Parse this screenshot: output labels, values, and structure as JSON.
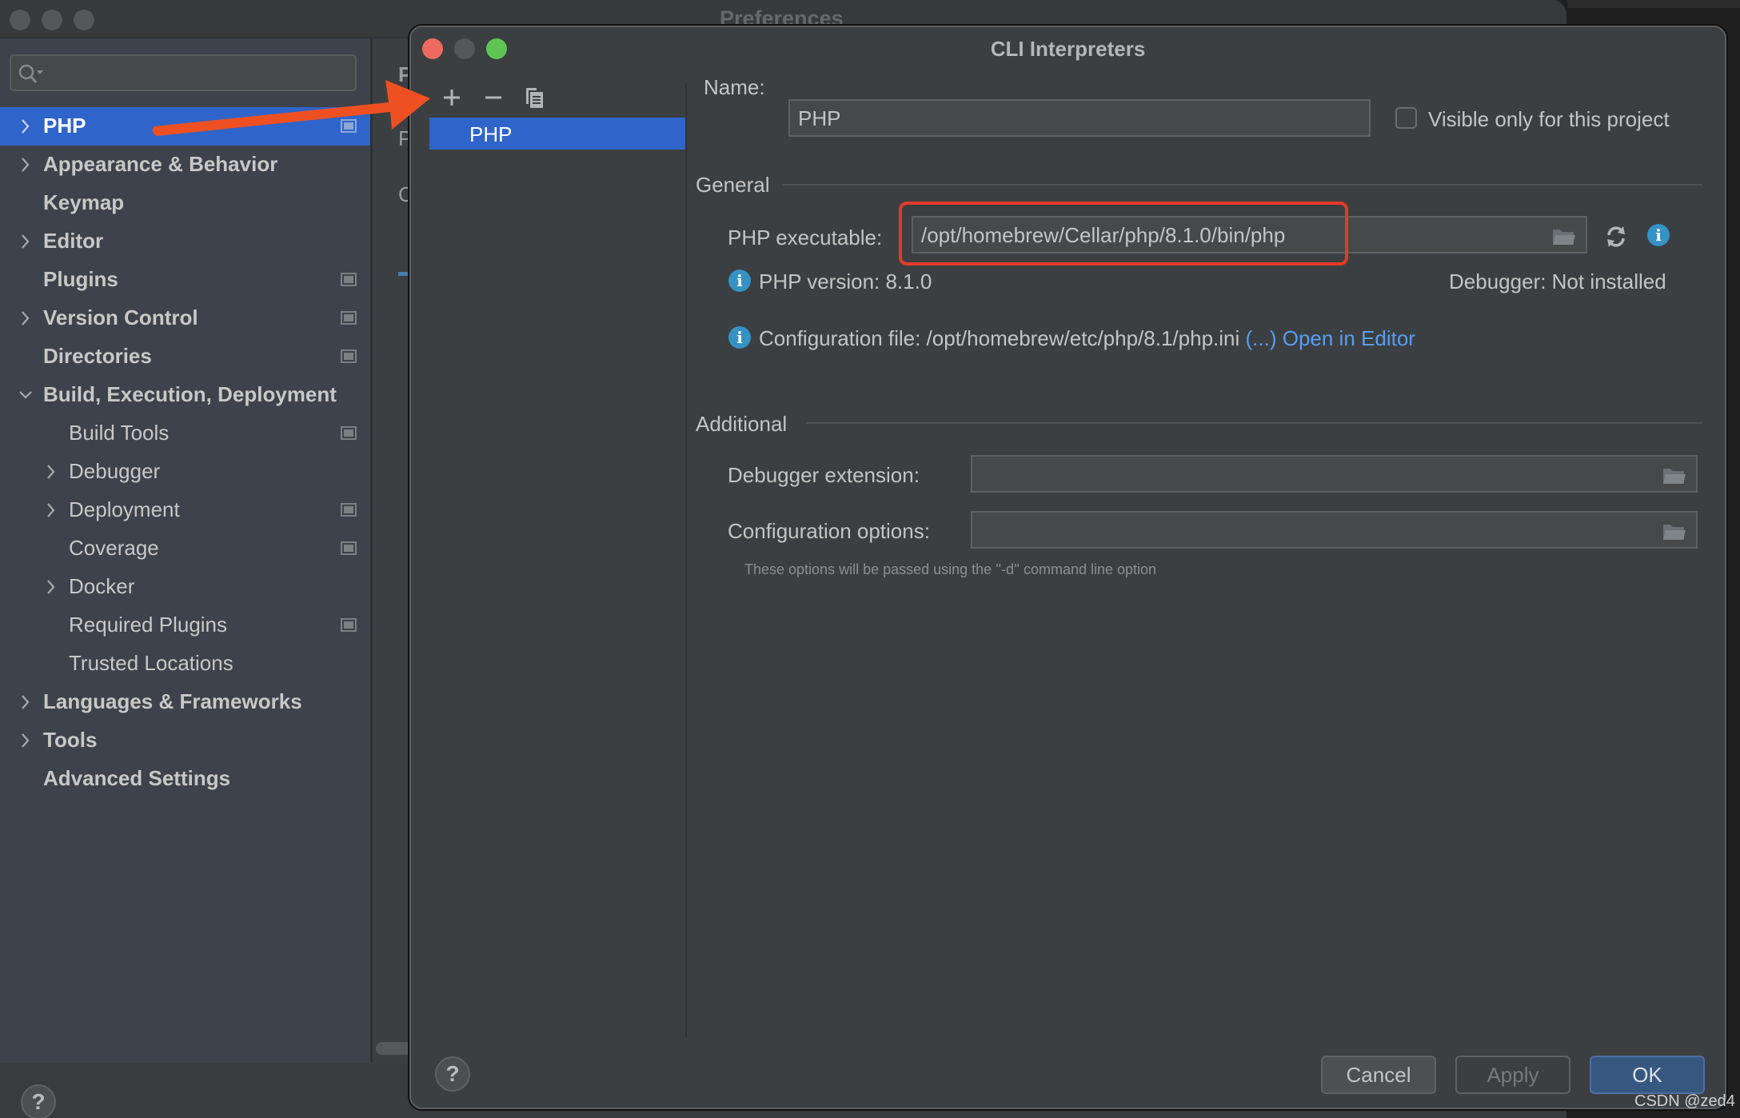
{
  "prefs_window": {
    "title": "Preferences",
    "search": {
      "placeholder": "",
      "value": "",
      "icon": "search-icon"
    },
    "sidebar": {
      "items": [
        {
          "label": "PHP",
          "bold": true,
          "expandable": true,
          "expanded": false,
          "selected": true,
          "project_icon": true,
          "level": 0
        },
        {
          "label": "Appearance & Behavior",
          "bold": true,
          "expandable": true,
          "expanded": false,
          "selected": false,
          "project_icon": false,
          "level": 0
        },
        {
          "label": "Keymap",
          "bold": true,
          "expandable": false,
          "selected": false,
          "project_icon": false,
          "level": 0
        },
        {
          "label": "Editor",
          "bold": true,
          "expandable": true,
          "expanded": false,
          "selected": false,
          "project_icon": false,
          "level": 0
        },
        {
          "label": "Plugins",
          "bold": true,
          "expandable": false,
          "selected": false,
          "project_icon": true,
          "level": 0
        },
        {
          "label": "Version Control",
          "bold": true,
          "expandable": true,
          "expanded": false,
          "selected": false,
          "project_icon": true,
          "level": 0
        },
        {
          "label": "Directories",
          "bold": true,
          "expandable": false,
          "selected": false,
          "project_icon": true,
          "level": 0
        },
        {
          "label": "Build, Execution, Deployment",
          "bold": true,
          "expandable": true,
          "expanded": true,
          "selected": false,
          "project_icon": false,
          "level": 0
        },
        {
          "label": "Build Tools",
          "bold": false,
          "expandable": false,
          "selected": false,
          "project_icon": true,
          "level": 1
        },
        {
          "label": "Debugger",
          "bold": false,
          "expandable": true,
          "expanded": false,
          "selected": false,
          "project_icon": false,
          "level": 1
        },
        {
          "label": "Deployment",
          "bold": false,
          "expandable": true,
          "expanded": false,
          "selected": false,
          "project_icon": true,
          "level": 1
        },
        {
          "label": "Coverage",
          "bold": false,
          "expandable": false,
          "selected": false,
          "project_icon": true,
          "level": 1
        },
        {
          "label": "Docker",
          "bold": false,
          "expandable": true,
          "expanded": false,
          "selected": false,
          "project_icon": false,
          "level": 1
        },
        {
          "label": "Required Plugins",
          "bold": false,
          "expandable": false,
          "selected": false,
          "project_icon": true,
          "level": 1
        },
        {
          "label": "Trusted Locations",
          "bold": false,
          "expandable": false,
          "selected": false,
          "project_icon": false,
          "level": 1
        },
        {
          "label": "Languages & Frameworks",
          "bold": true,
          "expandable": true,
          "expanded": false,
          "selected": false,
          "project_icon": false,
          "level": 0
        },
        {
          "label": "Tools",
          "bold": true,
          "expandable": true,
          "expanded": false,
          "selected": false,
          "project_icon": false,
          "level": 0
        },
        {
          "label": "Advanced Settings",
          "bold": true,
          "expandable": false,
          "selected": false,
          "project_icon": false,
          "level": 0
        }
      ]
    },
    "peek_labels": [
      "P",
      "P",
      "C"
    ],
    "help_label": "?"
  },
  "dialog": {
    "title": "CLI Interpreters",
    "toolbar": {
      "add_icon": "plus-icon",
      "remove_icon": "minus-icon",
      "copy_icon": "copy-icon"
    },
    "interpreters": [
      {
        "name": "PHP",
        "selected": true
      }
    ],
    "name_label": "Name:",
    "name_value": "PHP",
    "visible_only_label": "Visible only for this project",
    "visible_only_checked": false,
    "general": {
      "section_label": "General",
      "executable_label": "PHP executable:",
      "executable_value": "/opt/homebrew/Cellar/php/8.1.0/bin/php",
      "php_version": "PHP version: 8.1.0",
      "debugger_status": "Debugger: Not installed",
      "config_file": "Configuration file: /opt/homebrew/etc/php/8.1/php.ini",
      "config_more": "(...)",
      "open_in_editor": "Open in Editor"
    },
    "additional": {
      "section_label": "Additional",
      "debugger_ext_label": "Debugger extension:",
      "debugger_ext_value": "",
      "config_options_label": "Configuration options:",
      "config_options_value": "",
      "hint": "These options will be passed using the ''-d'' command line option"
    },
    "buttons": {
      "cancel": "Cancel",
      "apply": "Apply",
      "ok": "OK",
      "help": "?"
    }
  },
  "annotation": {
    "arrow_color": "#ee5022",
    "highlight_color": "#e33b26"
  },
  "watermark": "CSDN @zed4"
}
